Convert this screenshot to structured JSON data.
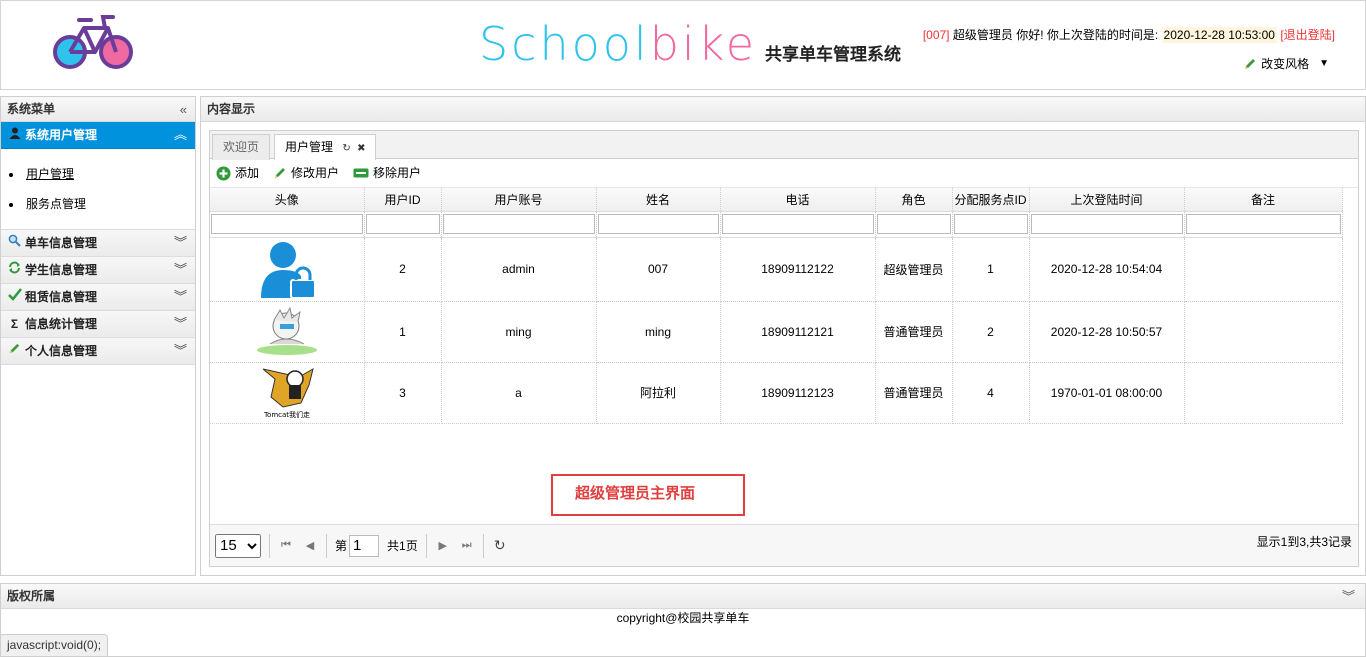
{
  "header": {
    "brand_a": "School",
    "brand_b": "bike",
    "brand_sub": "共享单车管理系统",
    "user_id": "[007]",
    "user_text": "超级管理员 你好! 你上次登陆的时间是:",
    "last_login": "2020-12-28 10:53:00",
    "logout_label": "[退出登陆]",
    "theme_label": "改变风格"
  },
  "sidebar": {
    "title": "系统菜单",
    "collapse_glyph": "«",
    "active_group": {
      "label": "系统用户管理",
      "items": [
        "用户管理",
        "服务点管理"
      ]
    },
    "groups": [
      {
        "label": "单车信息管理",
        "icon": "search-icon"
      },
      {
        "label": "学生信息管理",
        "icon": "refresh-icon"
      },
      {
        "label": "租赁信息管理",
        "icon": "check-icon"
      },
      {
        "label": "信息统计管理",
        "icon": "sigma-icon"
      },
      {
        "label": "个人信息管理",
        "icon": "pencil-icon"
      }
    ]
  },
  "main": {
    "title": "内容显示",
    "tabs": [
      "欢迎页",
      "用户管理"
    ],
    "toolbar": {
      "add": "添加",
      "edit": "修改用户",
      "remove": "移除用户"
    },
    "columns": [
      "头像",
      "用户ID",
      "用户账号",
      "姓名",
      "电话",
      "角色",
      "分配服务点ID",
      "上次登陆时间",
      "备注"
    ],
    "rows": [
      {
        "avatar": "admin-avatar",
        "id": "2",
        "account": "admin",
        "name": "007",
        "phone": "18909112122",
        "role": "超级管理员",
        "station": "1",
        "last": "2020-12-28 10:54:04",
        "note": ""
      },
      {
        "avatar": "anime-avatar",
        "id": "1",
        "account": "ming",
        "name": "ming",
        "phone": "18909112121",
        "role": "普通管理员",
        "station": "2",
        "last": "2020-12-28 10:50:57",
        "note": ""
      },
      {
        "avatar": "tomcat-avatar",
        "avatar_caption": "Tomcat我们走",
        "id": "3",
        "account": "a",
        "name": "阿拉利",
        "phone": "18909112123",
        "role": "普通管理员",
        "station": "4",
        "last": "1970-01-01 08:00:00",
        "note": ""
      }
    ],
    "annotation": "超级管理员主界面",
    "pager": {
      "page_size": "15",
      "page_prefix": "第",
      "page": "1",
      "page_suffix": "共1页",
      "info": "显示1到3,共3记录"
    }
  },
  "footer": {
    "title": "版权所属",
    "copyright": "copyright@校园共享单车",
    "status": "javascript:void(0);"
  },
  "colors": {
    "accent": "#0092dc",
    "brand_blue": "#2fc3ec",
    "brand_pink": "#f06aa2",
    "alert": "#e33"
  }
}
